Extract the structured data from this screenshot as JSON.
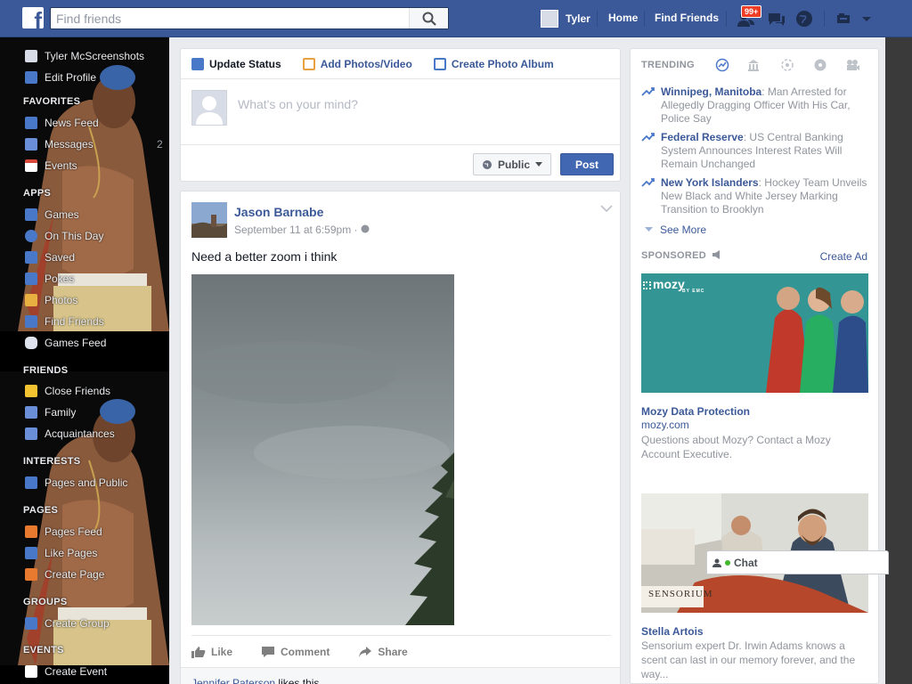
{
  "topbar": {
    "search_placeholder": "Find friends",
    "user_name": "Tyler",
    "home": "Home",
    "find_friends": "Find Friends",
    "notification_count": "99+"
  },
  "left_nav": {
    "profile_name": "Tyler McScreenshots",
    "edit_profile": "Edit Profile",
    "favorites": {
      "heading": "FAVORITES",
      "items": [
        "News Feed",
        "Messages",
        "Events"
      ]
    },
    "messages_count": "2",
    "apps": {
      "heading": "APPS",
      "items": [
        "Games",
        "On This Day",
        "Saved",
        "Pokes",
        "Photos",
        "Find Friends",
        "Games Feed"
      ]
    },
    "friends": {
      "heading": "FRIENDS",
      "items": [
        "Close Friends",
        "Family",
        "Acquaintances"
      ]
    },
    "interests": {
      "heading": "INTERESTS",
      "items": [
        "Pages and Public"
      ]
    },
    "pages": {
      "heading": "PAGES",
      "items": [
        "Pages Feed",
        "Like Pages",
        "Create Page"
      ]
    },
    "groups": {
      "heading": "GROUPS",
      "items": [
        "Create Group"
      ]
    },
    "events": {
      "heading": "EVENTS",
      "items": [
        "Create Event"
      ]
    }
  },
  "composer": {
    "tabs": [
      "Update Status",
      "Add Photos/Video",
      "Create Photo Album"
    ],
    "placeholder": "What's on your mind?",
    "audience": "Public",
    "post": "Post"
  },
  "story": {
    "author": "Jason Barnabe",
    "time": "September 11 at 6:59pm",
    "separator": "·",
    "text": "Need a better zoom i think",
    "actions": [
      "Like",
      "Comment",
      "Share"
    ],
    "liker": "Jennifer Paterson",
    "likes_suffix": " likes this."
  },
  "trending": {
    "heading": "TRENDING",
    "items": [
      {
        "topic": "Winnipeg, Manitoba",
        "desc": ": Man Arrested for Allegedly Dragging Officer With His Car, Police Say"
      },
      {
        "topic": "Federal Reserve",
        "desc": ": US Central Banking System Announces Interest Rates Will Remain Unchanged"
      },
      {
        "topic": "New York Islanders",
        "desc": ": Hockey Team Unveils New Black and White Jersey Marking Transition to Brooklyn"
      }
    ],
    "see_more": "See More"
  },
  "sponsored": {
    "heading": "SPONSORED",
    "create_ad": "Create Ad",
    "ads": [
      {
        "logo": "mozy",
        "logo_sub": "BY EMC",
        "title": "Mozy Data Protection",
        "url": "mozy.com",
        "body": "Questions about Mozy? Contact a Mozy Account Executive."
      },
      {
        "logo": "SENSORIUM",
        "title": "Stella Artois",
        "body": "Sensorium expert Dr. Irwin Adams knows a scent can last in our memory forever, and the way..."
      }
    ]
  },
  "chat": {
    "label": "Chat"
  },
  "colors": {
    "brand": "#3b5998",
    "link": "#3b5998",
    "post_button": "#4267b2",
    "badge": "#f03d25"
  },
  "icons": [
    "facebook-logo",
    "search-icon",
    "friend-requests-icon",
    "messages-icon",
    "globe-icon",
    "privacy-icon",
    "chevron-down-icon",
    "globe-small-icon",
    "like-icon",
    "comment-icon",
    "share-icon",
    "trending-arrow-icon",
    "megaphone-icon"
  ]
}
